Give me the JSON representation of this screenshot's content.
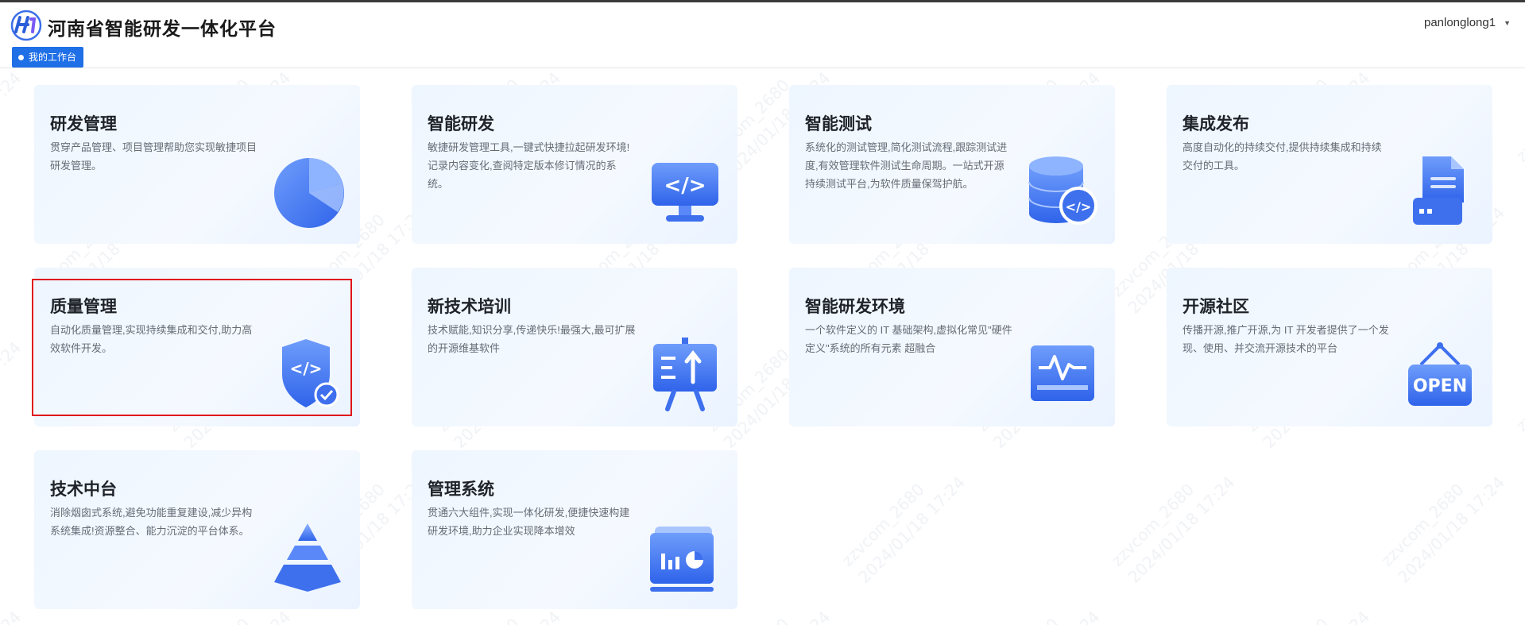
{
  "app": {
    "title": "河南省智能研发一体化平台",
    "user": "panlonglong1"
  },
  "tabs": [
    {
      "label": "我的工作台"
    }
  ],
  "cards": [
    {
      "title": "研发管理",
      "desc": "贯穿产品管理、项目管理帮助您实现敏捷项目研发管理。",
      "icon": "pie-chart-icon"
    },
    {
      "title": "智能研发",
      "desc": "敏捷研发管理工具,一键式快捷拉起研发环境!记录内容变化,查阅特定版本修订情况的系统。",
      "icon": "code-monitor-icon"
    },
    {
      "title": "智能测试",
      "desc": "系统化的测试管理,简化测试流程,跟踪测试进度,有效管理软件测试生命周期。一站式开源持续测试平台,为软件质量保驾护航。",
      "icon": "database-code-icon"
    },
    {
      "title": "集成发布",
      "desc": "高度自动化的持续交付,提供持续集成和持续交付的工具。",
      "icon": "document-server-icon"
    },
    {
      "title": "质量管理",
      "desc": "自动化质量管理,实现持续集成和交付,助力高效软件开发。",
      "icon": "shield-code-icon"
    },
    {
      "title": "新技术培训",
      "desc": "技术赋能,知识分享,传递快乐!最强大,最可扩展的开源维基软件",
      "icon": "presentation-board-icon"
    },
    {
      "title": "智能研发环境",
      "desc": "一个软件定义的 IT 基础架构,虚拟化常见\"硬件定义\"系统的所有元素 超融合",
      "icon": "monitor-pulse-icon"
    },
    {
      "title": "开源社区",
      "desc": "传播开源,推广开源,为 IT 开发者提供了一个发现、使用、并交流开源技术的平台",
      "icon": "open-sign-icon"
    },
    {
      "title": "技术中台",
      "desc": "消除烟囱式系统,避免功能重复建设,减少异构系统集成!资源整合、能力沉淀的平台体系。",
      "icon": "pyramid-icon"
    },
    {
      "title": "管理系统",
      "desc": "贯通六大组件,实现一体化研发,便捷快速构建研发环境,助力企业实现降本增效",
      "icon": "dashboard-window-icon"
    }
  ],
  "icon_labels": {
    "open_sign": "OPEN"
  },
  "colors": {
    "accent": "#1f6fe7",
    "highlight": "#e0151b",
    "icon_blue": "#4a7cf6"
  }
}
